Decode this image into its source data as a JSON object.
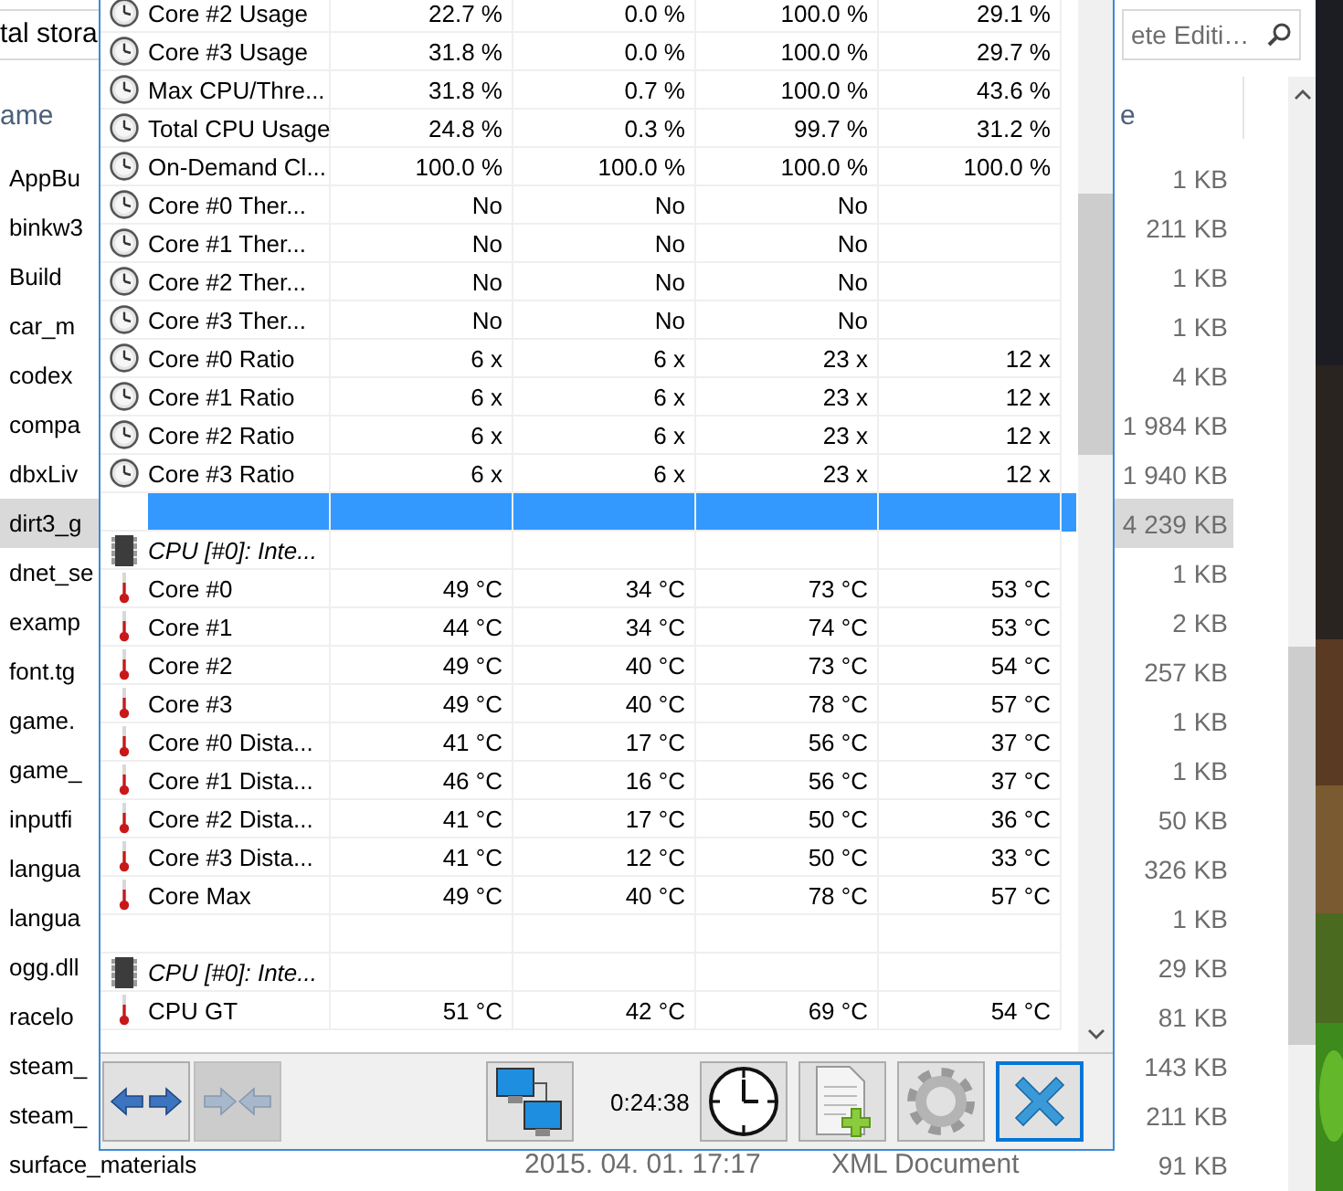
{
  "explorer": {
    "address": "tal stora",
    "search": {
      "value": "ete Editi…"
    },
    "columns": {
      "name": "ame",
      "size": "e"
    },
    "files": [
      {
        "name": "AppBu",
        "size": "1 KB",
        "selected": false
      },
      {
        "name": "binkw3",
        "size": "211 KB",
        "selected": false
      },
      {
        "name": "Build",
        "size": "1 KB",
        "selected": false
      },
      {
        "name": "car_m",
        "size": "1 KB",
        "selected": false
      },
      {
        "name": "codex",
        "size": "4 KB",
        "selected": false
      },
      {
        "name": "compa",
        "size": "1 984 KB",
        "selected": false
      },
      {
        "name": "dbxLiv",
        "size": "1 940 KB",
        "selected": false
      },
      {
        "name": "dirt3_g",
        "size": "4 239 KB",
        "selected": true
      },
      {
        "name": "dnet_se",
        "size": "1 KB",
        "selected": false
      },
      {
        "name": "examp",
        "size": "2 KB",
        "selected": false
      },
      {
        "name": "font.tg",
        "size": "257 KB",
        "selected": false
      },
      {
        "name": "game.",
        "size": "1 KB",
        "selected": false
      },
      {
        "name": "game_",
        "size": "1 KB",
        "selected": false
      },
      {
        "name": "inputfi",
        "size": "50 KB",
        "selected": false
      },
      {
        "name": "langua",
        "size": "326 KB",
        "selected": false
      },
      {
        "name": "langua",
        "size": "1 KB",
        "selected": false
      },
      {
        "name": "ogg.dll",
        "size": "29 KB",
        "selected": false
      },
      {
        "name": "racelo",
        "size": "81 KB",
        "selected": false
      },
      {
        "name": "steam_",
        "size": "143 KB",
        "selected": false
      },
      {
        "name": "steam_",
        "size": "211 KB",
        "selected": false
      },
      {
        "name": "surface_materials",
        "date": "2015. 04. 01. 17:17",
        "type": "XML Document",
        "size": "91 KB",
        "selected": false
      }
    ]
  },
  "sensors": {
    "rows": [
      {
        "kind": "gauge",
        "name": "Core #2 Usage",
        "values": [
          "22.7 %",
          "0.0 %",
          "100.0 %",
          "29.1 %"
        ],
        "selected": false
      },
      {
        "kind": "gauge",
        "name": "Core #3 Usage",
        "values": [
          "31.8 %",
          "0.0 %",
          "100.0 %",
          "29.7 %"
        ],
        "selected": false
      },
      {
        "kind": "gauge",
        "name": "Max CPU/Thre...",
        "values": [
          "31.8 %",
          "0.7 %",
          "100.0 %",
          "43.6 %"
        ],
        "selected": false
      },
      {
        "kind": "gauge",
        "name": "Total CPU Usage",
        "values": [
          "24.8 %",
          "0.3 %",
          "99.7 %",
          "31.2 %"
        ],
        "selected": false
      },
      {
        "kind": "gauge",
        "name": "On-Demand Cl...",
        "values": [
          "100.0 %",
          "100.0 %",
          "100.0 %",
          "100.0 %"
        ],
        "selected": false
      },
      {
        "kind": "gauge",
        "name": "Core #0 Ther...",
        "values": [
          "No",
          "No",
          "No"
        ],
        "selected": false
      },
      {
        "kind": "gauge",
        "name": "Core #1 Ther...",
        "values": [
          "No",
          "No",
          "No"
        ],
        "selected": false
      },
      {
        "kind": "gauge",
        "name": "Core #2 Ther...",
        "values": [
          "No",
          "No",
          "No"
        ],
        "selected": false
      },
      {
        "kind": "gauge",
        "name": "Core #3 Ther...",
        "values": [
          "No",
          "No",
          "No"
        ],
        "selected": false
      },
      {
        "kind": "gauge",
        "name": "Core #0 Ratio",
        "values": [
          "6 x",
          "6 x",
          "23 x",
          "12 x"
        ],
        "selected": false
      },
      {
        "kind": "gauge",
        "name": "Core #1 Ratio",
        "values": [
          "6 x",
          "6 x",
          "23 x",
          "12 x"
        ],
        "selected": false
      },
      {
        "kind": "gauge",
        "name": "Core #2 Ratio",
        "values": [
          "6 x",
          "6 x",
          "23 x",
          "12 x"
        ],
        "selected": false
      },
      {
        "kind": "gauge",
        "name": "Core #3 Ratio",
        "values": [
          "6 x",
          "6 x",
          "23 x",
          "12 x"
        ],
        "selected": false
      },
      {
        "kind": "blank",
        "selected": true
      },
      {
        "kind": "group",
        "name": "CPU [#0]: Inte...",
        "selected": false
      },
      {
        "kind": "temperature",
        "name": "Core #0",
        "values": [
          "49 °C",
          "34 °C",
          "73 °C",
          "53 °C"
        ],
        "selected": false
      },
      {
        "kind": "temperature",
        "name": "Core #1",
        "values": [
          "44 °C",
          "34 °C",
          "74 °C",
          "53 °C"
        ],
        "selected": false
      },
      {
        "kind": "temperature",
        "name": "Core #2",
        "values": [
          "49 °C",
          "40 °C",
          "73 °C",
          "54 °C"
        ],
        "selected": false
      },
      {
        "kind": "temperature",
        "name": "Core #3",
        "values": [
          "49 °C",
          "40 °C",
          "78 °C",
          "57 °C"
        ],
        "selected": false
      },
      {
        "kind": "temperature",
        "name": "Core #0 Dista...",
        "values": [
          "41 °C",
          "17 °C",
          "56 °C",
          "37 °C"
        ],
        "selected": false
      },
      {
        "kind": "temperature",
        "name": "Core #1 Dista...",
        "values": [
          "46 °C",
          "16 °C",
          "56 °C",
          "37 °C"
        ],
        "selected": false
      },
      {
        "kind": "temperature",
        "name": "Core #2 Dista...",
        "values": [
          "41 °C",
          "17 °C",
          "50 °C",
          "36 °C"
        ],
        "selected": false
      },
      {
        "kind": "temperature",
        "name": "Core #3 Dista...",
        "values": [
          "41 °C",
          "12 °C",
          "50 °C",
          "33 °C"
        ],
        "selected": false
      },
      {
        "kind": "temperature",
        "name": "Core Max",
        "values": [
          "49 °C",
          "40 °C",
          "78 °C",
          "57 °C"
        ],
        "selected": false
      },
      {
        "kind": "blank",
        "selected": false
      },
      {
        "kind": "group",
        "name": "CPU [#0]: Inte...",
        "selected": false
      },
      {
        "kind": "temperature",
        "name": "CPU GT",
        "values": [
          "51 °C",
          "42 °C",
          "69 °C",
          "54 °C"
        ],
        "selected": false
      }
    ],
    "toolbar": [
      {
        "kind": "arrows",
        "disabled": false,
        "focused": false
      },
      {
        "kind": "reverse-arrows",
        "disabled": true,
        "focused": false
      },
      {
        "kind": "network",
        "disabled": false,
        "focused": false
      },
      {
        "kind": "timer",
        "text": "0:24:38"
      },
      {
        "kind": "clock",
        "disabled": false,
        "focused": false
      },
      {
        "kind": "report",
        "disabled": false,
        "focused": false
      },
      {
        "kind": "settings",
        "disabled": false,
        "focused": false
      },
      {
        "kind": "close",
        "disabled": false,
        "focused": true
      }
    ]
  }
}
